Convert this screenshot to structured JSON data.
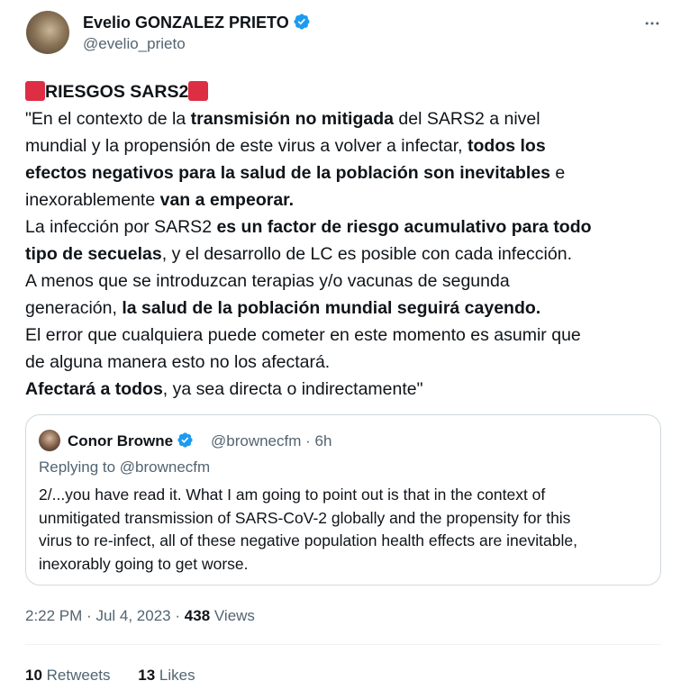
{
  "author": {
    "name": "Evelio GONZALEZ PRIETO",
    "handle": "@evelio_prieto"
  },
  "tweet": {
    "title": "RIESGOS SARS2",
    "lines": [
      [
        {
          "t": "\"En el contexto de la "
        },
        {
          "t": "transmisión no mitigada",
          "b": true
        },
        {
          "t": " del SARS2 a nivel"
        }
      ],
      [
        {
          "t": "mundial y la propensión de este virus a volver a infectar, "
        },
        {
          "t": "todos los",
          "b": true
        }
      ],
      [
        {
          "t": "efectos negativos para la salud de la población son inevitables",
          "b": true
        },
        {
          "t": " e"
        }
      ],
      [
        {
          "t": "inexorablemente "
        },
        {
          "t": "van a empeorar.",
          "b": true
        }
      ],
      [
        {
          "t": "La infección por SARS2 "
        },
        {
          "t": "es un factor de riesgo acumulativo para todo",
          "b": true
        }
      ],
      [
        {
          "t": "tipo de secuelas",
          "b": true
        },
        {
          "t": ", y el desarrollo de LC es posible con cada infección."
        }
      ],
      [
        {
          "t": "A menos que se introduzcan terapias y/o vacunas de segunda"
        }
      ],
      [
        {
          "t": "generación, "
        },
        {
          "t": "la salud de la población mundial seguirá cayendo.",
          "b": true
        }
      ],
      [
        {
          "t": "El error que cualquiera puede cometer en este momento es asumir que"
        }
      ],
      [
        {
          "t": "de alguna manera esto no los afectará."
        }
      ],
      [
        {
          "t": "Afectará a todos",
          "b": true
        },
        {
          "t": ", ya sea directa o indirectamente\""
        }
      ]
    ]
  },
  "quote": {
    "name": "Conor Browne",
    "handle": "@brownecfm",
    "separator": "·",
    "time": "6h",
    "replying": "Replying to @brownecfm",
    "lines": [
      "2/...you have read it. What I am going to point out is that in the context of",
      "unmitigated transmission of SARS-CoV-2 globally and the propensity for this",
      "virus to re-infect, all of these negative population health effects are inevitable,",
      "inexorably going to get worse."
    ]
  },
  "meta": {
    "time": "2:22 PM",
    "date": "Jul 4, 2023",
    "separator": "·",
    "views_count": "438",
    "views_label": "Views"
  },
  "stats": {
    "retweets_count": "10",
    "retweets_label": "Retweets",
    "likes_count": "13",
    "likes_label": "Likes"
  },
  "colors": {
    "verified": "#1d9bf0",
    "red_square": "#dd2e44",
    "secondary_text": "#536471",
    "border": "#cfd9de"
  },
  "icons": {
    "verified": "verified-badge-icon",
    "more": "more-dots-icon",
    "red_square": "red-square-emoji"
  }
}
